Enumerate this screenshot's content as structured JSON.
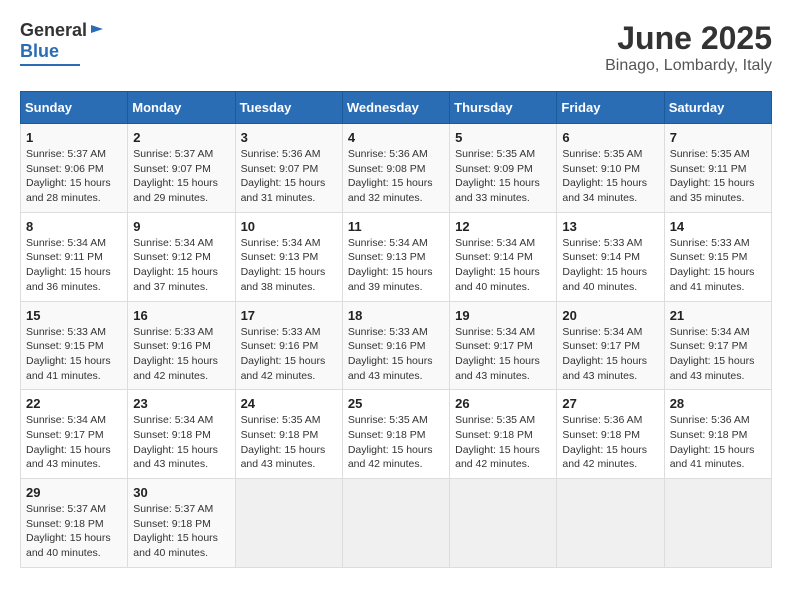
{
  "logo": {
    "general": "General",
    "blue": "Blue"
  },
  "title": "June 2025",
  "subtitle": "Binago, Lombardy, Italy",
  "headers": [
    "Sunday",
    "Monday",
    "Tuesday",
    "Wednesday",
    "Thursday",
    "Friday",
    "Saturday"
  ],
  "rows": [
    [
      {
        "day": "1",
        "info": "Sunrise: 5:37 AM\nSunset: 9:06 PM\nDaylight: 15 hours\nand 28 minutes."
      },
      {
        "day": "2",
        "info": "Sunrise: 5:37 AM\nSunset: 9:07 PM\nDaylight: 15 hours\nand 29 minutes."
      },
      {
        "day": "3",
        "info": "Sunrise: 5:36 AM\nSunset: 9:07 PM\nDaylight: 15 hours\nand 31 minutes."
      },
      {
        "day": "4",
        "info": "Sunrise: 5:36 AM\nSunset: 9:08 PM\nDaylight: 15 hours\nand 32 minutes."
      },
      {
        "day": "5",
        "info": "Sunrise: 5:35 AM\nSunset: 9:09 PM\nDaylight: 15 hours\nand 33 minutes."
      },
      {
        "day": "6",
        "info": "Sunrise: 5:35 AM\nSunset: 9:10 PM\nDaylight: 15 hours\nand 34 minutes."
      },
      {
        "day": "7",
        "info": "Sunrise: 5:35 AM\nSunset: 9:11 PM\nDaylight: 15 hours\nand 35 minutes."
      }
    ],
    [
      {
        "day": "8",
        "info": "Sunrise: 5:34 AM\nSunset: 9:11 PM\nDaylight: 15 hours\nand 36 minutes."
      },
      {
        "day": "9",
        "info": "Sunrise: 5:34 AM\nSunset: 9:12 PM\nDaylight: 15 hours\nand 37 minutes."
      },
      {
        "day": "10",
        "info": "Sunrise: 5:34 AM\nSunset: 9:13 PM\nDaylight: 15 hours\nand 38 minutes."
      },
      {
        "day": "11",
        "info": "Sunrise: 5:34 AM\nSunset: 9:13 PM\nDaylight: 15 hours\nand 39 minutes."
      },
      {
        "day": "12",
        "info": "Sunrise: 5:34 AM\nSunset: 9:14 PM\nDaylight: 15 hours\nand 40 minutes."
      },
      {
        "day": "13",
        "info": "Sunrise: 5:33 AM\nSunset: 9:14 PM\nDaylight: 15 hours\nand 40 minutes."
      },
      {
        "day": "14",
        "info": "Sunrise: 5:33 AM\nSunset: 9:15 PM\nDaylight: 15 hours\nand 41 minutes."
      }
    ],
    [
      {
        "day": "15",
        "info": "Sunrise: 5:33 AM\nSunset: 9:15 PM\nDaylight: 15 hours\nand 41 minutes."
      },
      {
        "day": "16",
        "info": "Sunrise: 5:33 AM\nSunset: 9:16 PM\nDaylight: 15 hours\nand 42 minutes."
      },
      {
        "day": "17",
        "info": "Sunrise: 5:33 AM\nSunset: 9:16 PM\nDaylight: 15 hours\nand 42 minutes."
      },
      {
        "day": "18",
        "info": "Sunrise: 5:33 AM\nSunset: 9:16 PM\nDaylight: 15 hours\nand 43 minutes."
      },
      {
        "day": "19",
        "info": "Sunrise: 5:34 AM\nSunset: 9:17 PM\nDaylight: 15 hours\nand 43 minutes."
      },
      {
        "day": "20",
        "info": "Sunrise: 5:34 AM\nSunset: 9:17 PM\nDaylight: 15 hours\nand 43 minutes."
      },
      {
        "day": "21",
        "info": "Sunrise: 5:34 AM\nSunset: 9:17 PM\nDaylight: 15 hours\nand 43 minutes."
      }
    ],
    [
      {
        "day": "22",
        "info": "Sunrise: 5:34 AM\nSunset: 9:17 PM\nDaylight: 15 hours\nand 43 minutes."
      },
      {
        "day": "23",
        "info": "Sunrise: 5:34 AM\nSunset: 9:18 PM\nDaylight: 15 hours\nand 43 minutes."
      },
      {
        "day": "24",
        "info": "Sunrise: 5:35 AM\nSunset: 9:18 PM\nDaylight: 15 hours\nand 43 minutes."
      },
      {
        "day": "25",
        "info": "Sunrise: 5:35 AM\nSunset: 9:18 PM\nDaylight: 15 hours\nand 42 minutes."
      },
      {
        "day": "26",
        "info": "Sunrise: 5:35 AM\nSunset: 9:18 PM\nDaylight: 15 hours\nand 42 minutes."
      },
      {
        "day": "27",
        "info": "Sunrise: 5:36 AM\nSunset: 9:18 PM\nDaylight: 15 hours\nand 42 minutes."
      },
      {
        "day": "28",
        "info": "Sunrise: 5:36 AM\nSunset: 9:18 PM\nDaylight: 15 hours\nand 41 minutes."
      }
    ],
    [
      {
        "day": "29",
        "info": "Sunrise: 5:37 AM\nSunset: 9:18 PM\nDaylight: 15 hours\nand 40 minutes."
      },
      {
        "day": "30",
        "info": "Sunrise: 5:37 AM\nSunset: 9:18 PM\nDaylight: 15 hours\nand 40 minutes."
      },
      {
        "day": "",
        "info": ""
      },
      {
        "day": "",
        "info": ""
      },
      {
        "day": "",
        "info": ""
      },
      {
        "day": "",
        "info": ""
      },
      {
        "day": "",
        "info": ""
      }
    ]
  ]
}
